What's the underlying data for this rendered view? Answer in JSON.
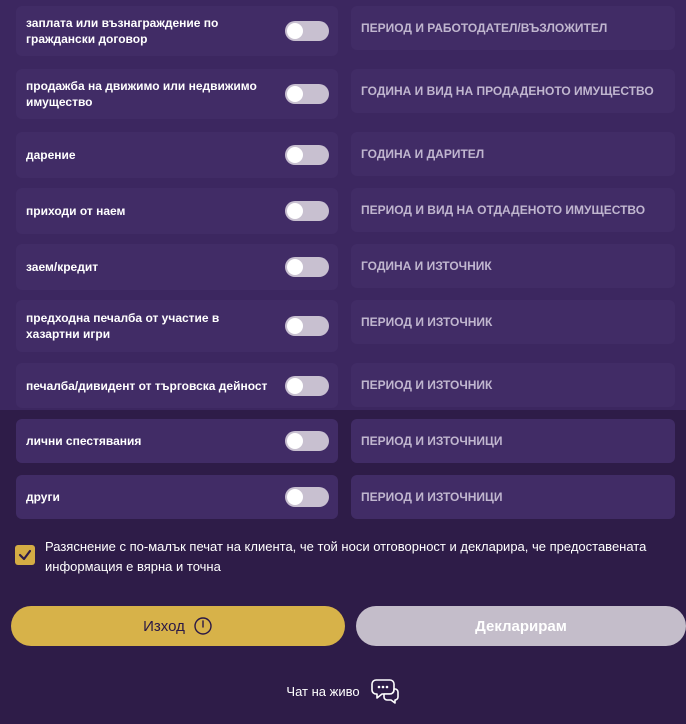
{
  "income_sources": [
    {
      "label": "заплата или възнаграждение по граждански договор",
      "placeholder": "ПЕРИОД И РАБОТОДАТЕЛ/ВЪЗЛОЖИТЕЛ"
    },
    {
      "label": "продажба на движимо или недвижимо имущество",
      "placeholder": "ГОДИНА И ВИД НА ПРОДАДЕНОТО ИМУЩЕСТВО"
    },
    {
      "label": "дарение",
      "placeholder": "ГОДИНА И ДАРИТЕЛ"
    },
    {
      "label": "приходи от наем",
      "placeholder": "ПЕРИОД И ВИД НА ОТДАДЕНОТО ИМУЩЕСТВО"
    },
    {
      "label": "заем/кредит",
      "placeholder": "ГОДИНА И ИЗТОЧНИК"
    },
    {
      "label": "предходна печалба от участие в хазартни игри",
      "placeholder": "ПЕРИОД И ИЗТОЧНИК"
    },
    {
      "label": "печалба/дивидент от търговска дейност",
      "placeholder": "ПЕРИОД И ИЗТОЧНИК"
    },
    {
      "label": "лични спестявания",
      "placeholder": "ПЕРИОД И ИЗТОЧНИЦИ"
    },
    {
      "label": "други",
      "placeholder": "ПЕРИОД И ИЗТОЧНИЦИ"
    }
  ],
  "confirmation": {
    "checked": true,
    "text": "Разяснение с по-малък печат на клиента, че той носи отговорност и декларира, че предоставената информация е вярна и точна"
  },
  "buttons": {
    "exit_label": "Изход",
    "declare_label": "Декларирам"
  },
  "chat": {
    "label": "Чат на живо"
  },
  "colors": {
    "background": "#2e1c48",
    "card": "#412c66",
    "accent_gold": "#d7b249",
    "toggle_off": "#c8c0d0"
  }
}
